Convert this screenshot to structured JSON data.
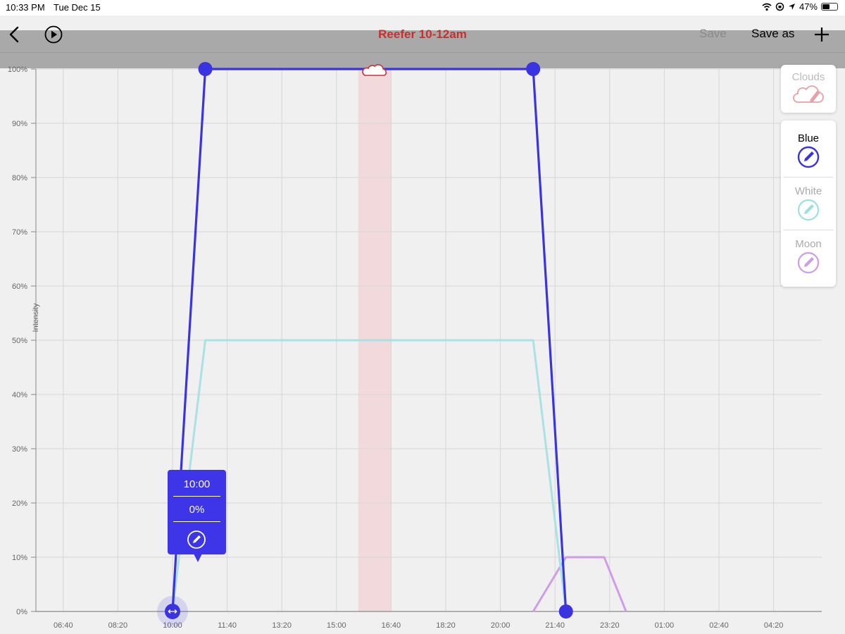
{
  "status": {
    "time": "10:33 PM",
    "date": "Tue Dec 15",
    "battery": "47%"
  },
  "toolbar": {
    "title": "Reefer 10-12am",
    "save_label": "Save",
    "save_as_label": "Save as"
  },
  "panels": {
    "clouds": {
      "label": "Clouds",
      "color": "#e8a0a8"
    },
    "channels": [
      {
        "label": "Blue",
        "color": "#3a33e0",
        "active": true
      },
      {
        "label": "White",
        "color": "#9ee0e0",
        "active": false
      },
      {
        "label": "Moon",
        "color": "#cf9ce8",
        "active": false
      }
    ]
  },
  "tooltip": {
    "time": "10:00",
    "value": "0%"
  },
  "chart_data": {
    "type": "line",
    "ylabel": "Intensity",
    "y_ticks": [
      "0%",
      "10%",
      "20%",
      "30%",
      "40%",
      "50%",
      "60%",
      "70%",
      "80%",
      "90%",
      "100%"
    ],
    "x_ticks": [
      "06:40",
      "08:20",
      "10:00",
      "11:40",
      "13:20",
      "15:00",
      "16:40",
      "18:20",
      "20:00",
      "21:40",
      "23:20",
      "01:00",
      "02:40",
      "04:20"
    ],
    "ylim": [
      0,
      100
    ],
    "grid": true,
    "cloud_band": {
      "start": "15:40",
      "end": "16:40"
    },
    "series": [
      {
        "name": "Blue",
        "color": "#3a33e0",
        "points": [
          [
            "10:00",
            0
          ],
          [
            "11:00",
            100
          ],
          [
            "21:00",
            100
          ],
          [
            "22:00",
            0
          ]
        ]
      },
      {
        "name": "White",
        "color": "#a8e2e2",
        "points": [
          [
            "10:00",
            0
          ],
          [
            "11:00",
            50
          ],
          [
            "21:00",
            50
          ],
          [
            "22:00",
            0
          ]
        ]
      },
      {
        "name": "Moon",
        "color": "#cf9ce8",
        "points": [
          [
            "21:00",
            0
          ],
          [
            "22:00",
            10
          ],
          [
            "23:10",
            10
          ],
          [
            "23:50",
            0
          ]
        ]
      }
    ]
  }
}
